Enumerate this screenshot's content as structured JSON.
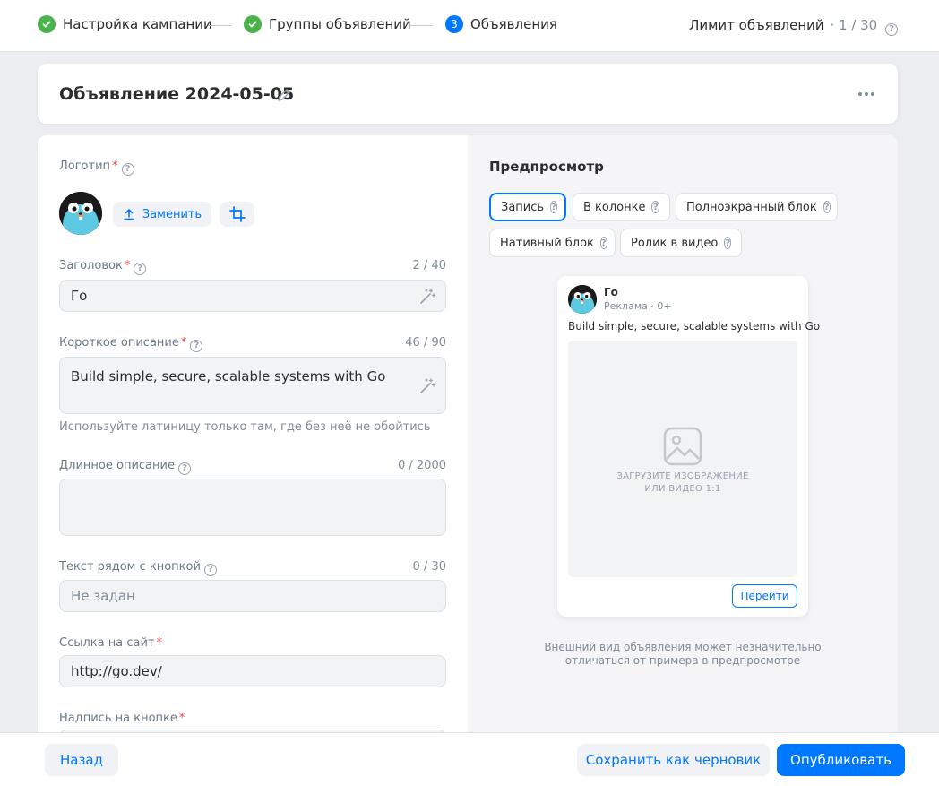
{
  "steps": [
    {
      "label": "Настройка кампании",
      "state": "done"
    },
    {
      "label": "Группы объявлений",
      "state": "done"
    },
    {
      "label": "Объявления",
      "state": "current",
      "number": "3"
    }
  ],
  "limit": {
    "label": "Лимит объявлений",
    "count": "· 1 / 30"
  },
  "ad": {
    "title": "Объявление 2024-05-05"
  },
  "form": {
    "logo": {
      "label": "Логотип",
      "replace_label": "Заменить"
    },
    "headline": {
      "label": "Заголовок",
      "counter": "2 / 40",
      "value": "Го"
    },
    "short_desc": {
      "label": "Короткое описание",
      "counter": "46 / 90",
      "value": "Build simple, secure, scalable systems with Go",
      "hint": "Используйте латиницу только там, где без неё не обойтись"
    },
    "long_desc": {
      "label": "Длинное описание",
      "counter": "0 / 2000",
      "value": ""
    },
    "button_text": {
      "label": "Текст рядом с кнопкой",
      "counter": "0 / 30",
      "placeholder": "Не задан"
    },
    "site_link": {
      "label": "Ссылка на сайт",
      "value": "http://go.dev/"
    },
    "button_caption": {
      "label": "Надпись на кнопке"
    }
  },
  "preview": {
    "title": "Предпросмотр",
    "formats": [
      "Запись",
      "В колонке",
      "Полноэкранный блок",
      "Нативный блок",
      "Ролик в видео"
    ],
    "active_format": "Запись",
    "card": {
      "name": "Го",
      "meta": "Реклама · 0+",
      "description": "Build simple, secure, scalable systems with Go",
      "upload_line1": "ЗАГРУЗИТЕ ИЗОБРАЖЕНИЕ",
      "upload_line2": "ИЛИ ВИДЕО 1:1",
      "button": "Перейти"
    },
    "note_line1": "Внешний вид объявления может незначительно",
    "note_line2": "отличаться от примера в предпросмотре"
  },
  "footer": {
    "back": "Назад",
    "draft": "Сохранить как черновик",
    "publish": "Опубликовать"
  },
  "colors": {
    "accent": "#0077ff",
    "success": "#4bb34b",
    "required": "#e64646",
    "logo_bg": "#1a1a1a",
    "gopher": "#5dc9e2"
  }
}
